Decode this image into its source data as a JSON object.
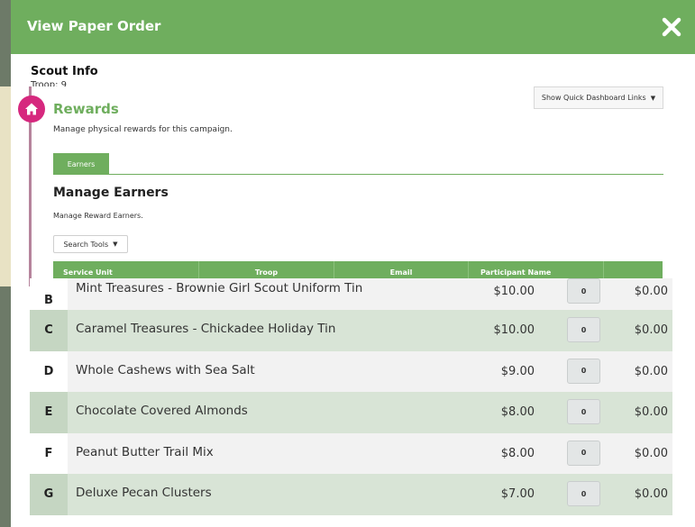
{
  "modal": {
    "title": "View Paper Order"
  },
  "scout_info": {
    "title": "Scout Info",
    "troop_label": "Troop: 9"
  },
  "rewards_panel": {
    "title": "Rewards",
    "subtitle": "Manage physical rewards for this campaign.",
    "dashboard_button": "Show Quick Dashboard Links",
    "tabs": [
      {
        "label": "Earners",
        "active": true
      }
    ],
    "section_title": "Manage Earners",
    "section_subtitle": "Manage Reward Earners.",
    "search_tools": "Search Tools",
    "columns": [
      "Service Unit",
      "Troop",
      "Email",
      "Participant Name",
      ""
    ]
  },
  "products": [
    {
      "letter": "B",
      "name": "Mint Treasures - Brownie Girl Scout Uniform Tin",
      "price": "$10.00",
      "qty": "0",
      "total": "$0.00"
    },
    {
      "letter": "C",
      "name": "Caramel Treasures - Chickadee Holiday Tin",
      "price": "$10.00",
      "qty": "0",
      "total": "$0.00"
    },
    {
      "letter": "D",
      "name": "Whole Cashews with Sea Salt",
      "price": "$9.00",
      "qty": "0",
      "total": "$0.00"
    },
    {
      "letter": "E",
      "name": "Chocolate Covered Almonds",
      "price": "$8.00",
      "qty": "0",
      "total": "$0.00"
    },
    {
      "letter": "F",
      "name": "Peanut Butter Trail Mix",
      "price": "$8.00",
      "qty": "0",
      "total": "$0.00"
    },
    {
      "letter": "G",
      "name": "Deluxe Pecan Clusters",
      "price": "$7.00",
      "qty": "0",
      "total": "$0.00"
    }
  ],
  "colors": {
    "brand_green": "#6fae5e",
    "home_badge": "#d6287e",
    "row_alt": "#d8e4d6"
  }
}
